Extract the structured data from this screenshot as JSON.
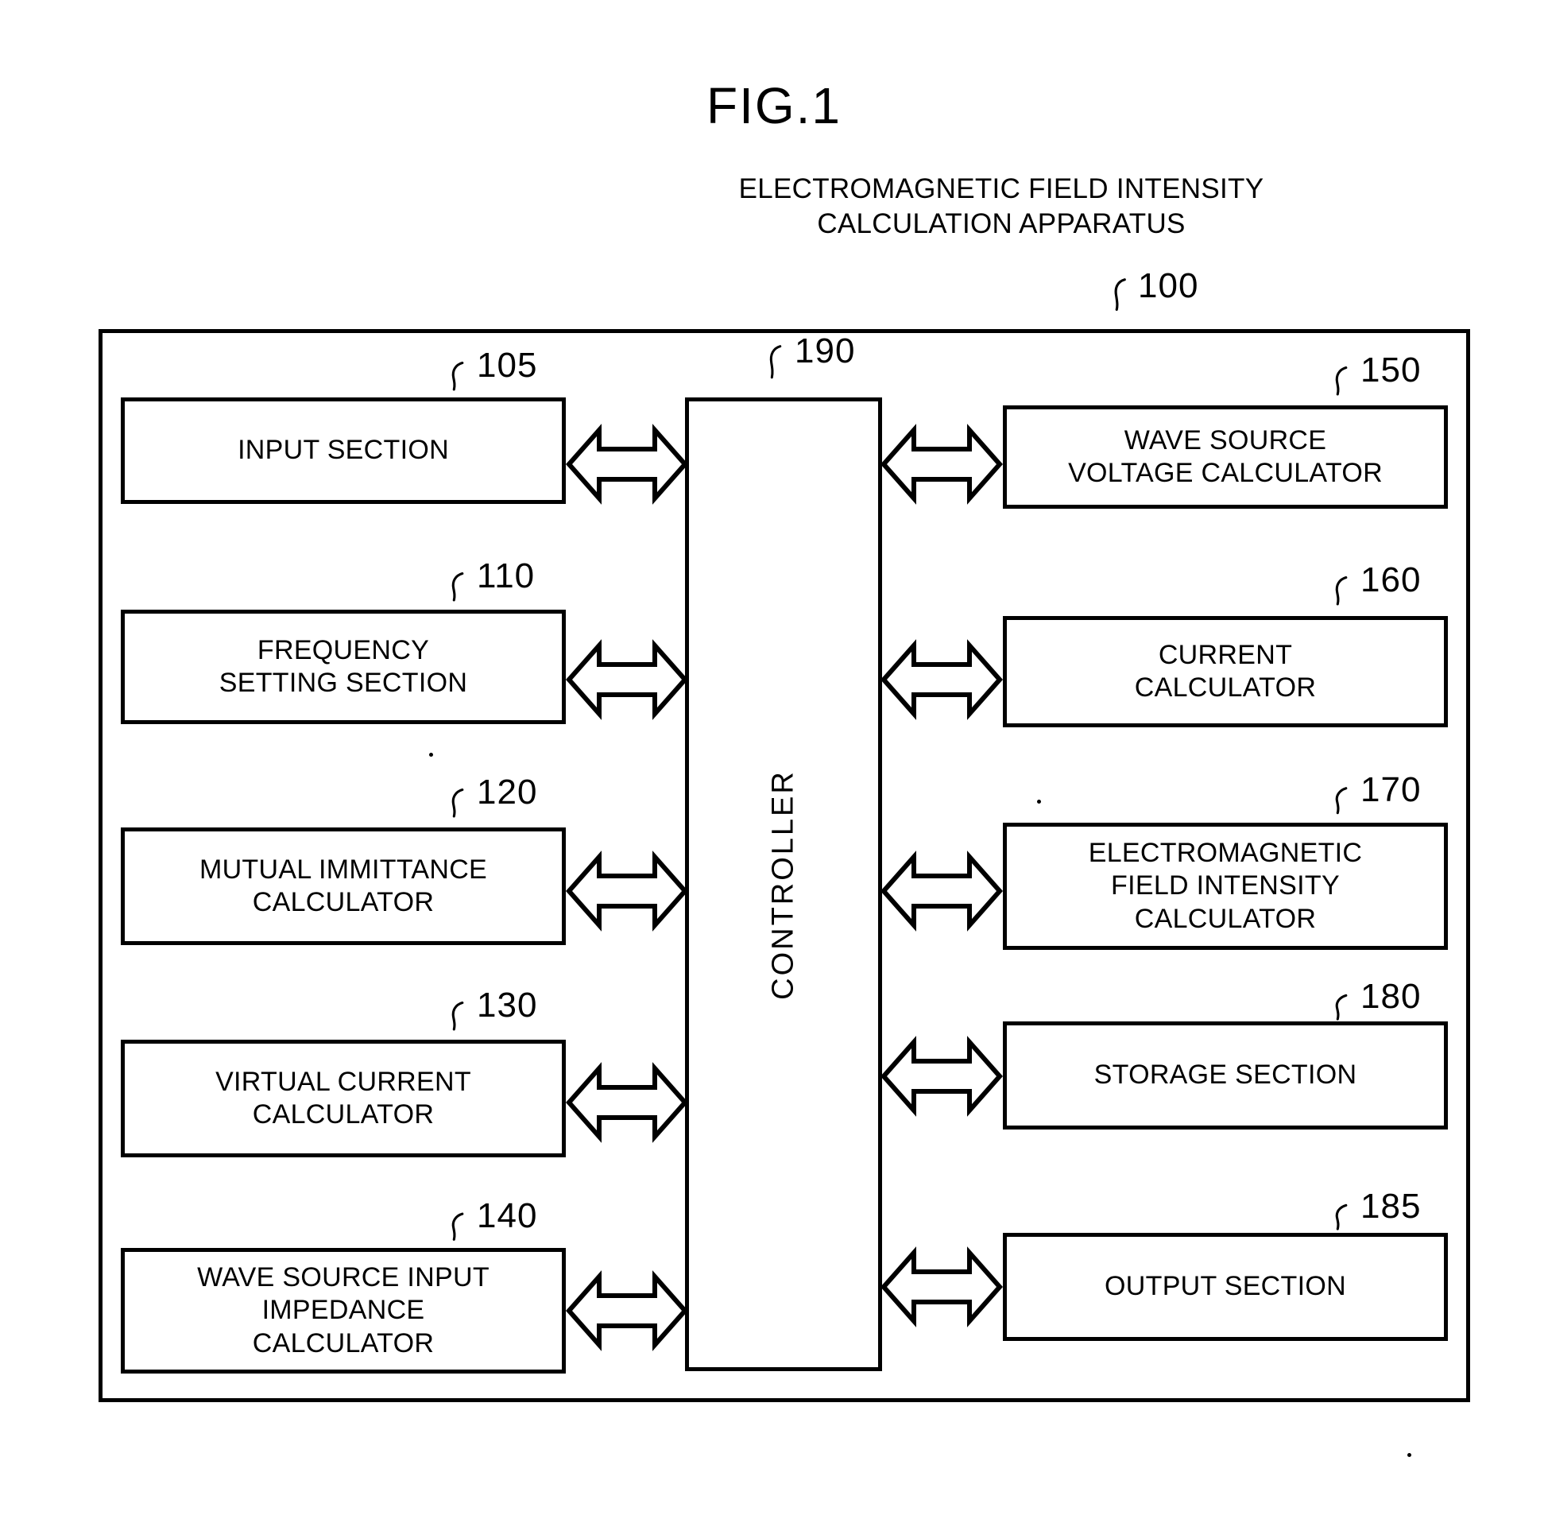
{
  "figure": {
    "title": "FIG.1"
  },
  "apparatus": {
    "caption_line1": "ELECTROMAGNETIC FIELD INTENSITY",
    "caption_line2": "CALCULATION APPARATUS",
    "ref": "100"
  },
  "controller": {
    "label": "CONTROLLER",
    "ref": "190"
  },
  "left_modules": [
    {
      "label": "INPUT SECTION",
      "ref": "105"
    },
    {
      "label": "FREQUENCY\nSETTING SECTION",
      "ref": "110"
    },
    {
      "label": "MUTUAL IMMITTANCE\nCALCULATOR",
      "ref": "120"
    },
    {
      "label": "VIRTUAL CURRENT\nCALCULATOR",
      "ref": "130"
    },
    {
      "label": "WAVE SOURCE INPUT\nIMPEDANCE\nCALCULATOR",
      "ref": "140"
    }
  ],
  "right_modules": [
    {
      "label": "WAVE SOURCE\nVOLTAGE CALCULATOR",
      "ref": "150"
    },
    {
      "label": "CURRENT\nCALCULATOR",
      "ref": "160"
    },
    {
      "label": "ELECTROMAGNETIC\nFIELD INTENSITY\nCALCULATOR",
      "ref": "170"
    },
    {
      "label": "STORAGE SECTION",
      "ref": "180"
    },
    {
      "label": "OUTPUT SECTION",
      "ref": "185"
    }
  ],
  "connectors": {
    "left_arrow_name": "bidirectional-arrow",
    "right_arrow_name": "bidirectional-arrow",
    "count_left": 5,
    "count_right": 5
  },
  "colors": {
    "ink": "#000000",
    "paper": "#ffffff"
  }
}
